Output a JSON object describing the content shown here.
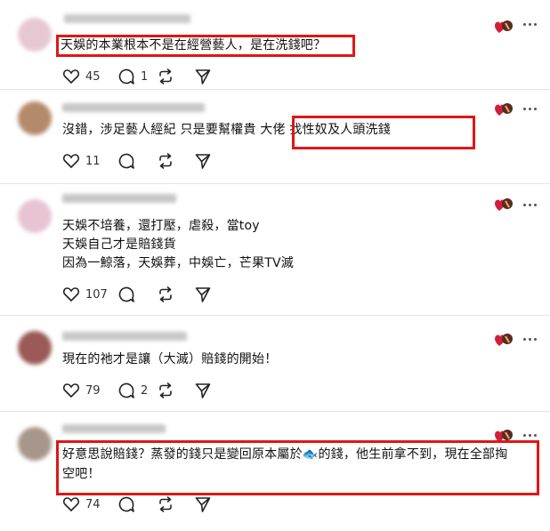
{
  "posts": [
    {
      "text": "天娛的本業根本不是在經營藝人，是在洗錢吧？",
      "like_count": "45",
      "reply_count": "1",
      "repost_count": "",
      "avatar_color": "#e6c8d2"
    },
    {
      "text_a": "沒錯，涉足藝人經紀 只是要幫權貴 大佬 ",
      "text_b": "找性奴及人頭洗錢",
      "like_count": "11",
      "reply_count": "",
      "repost_count": "",
      "avatar_color": "#b58a6a"
    },
    {
      "line1": "天娛不培養，還打壓，虐殺，當toy",
      "line2": "天娛自己才是賠錢貨",
      "line3": "因為一鯨落，天娛葬，中娛亡，芒果TV滅",
      "like_count": "107",
      "reply_count": "",
      "repost_count": "",
      "avatar_color": "#e8c3d4"
    },
    {
      "text": "現在的祂才是讓（大滅）賠錢的開始！",
      "like_count": "79",
      "reply_count": "2",
      "repost_count": "",
      "avatar_color": "#9b5a57"
    },
    {
      "line1_a": "好意思說賠錢？蒸發的錢只是變回原本屬於",
      "line1_b": "的錢，他生前拿不到，現在全部掏",
      "line2": "空吧！",
      "emoji": "🐟",
      "like_count": "74",
      "reply_count": "",
      "repost_count": "",
      "avatar_color": "#a7968a"
    }
  ],
  "colors": {
    "highlight": "#e01616",
    "heart_badge": "#d11f3a"
  },
  "icons": [
    "heart-icon",
    "reply-icon",
    "repost-icon",
    "share-icon",
    "more-icon",
    "heart-badge-icon"
  ]
}
